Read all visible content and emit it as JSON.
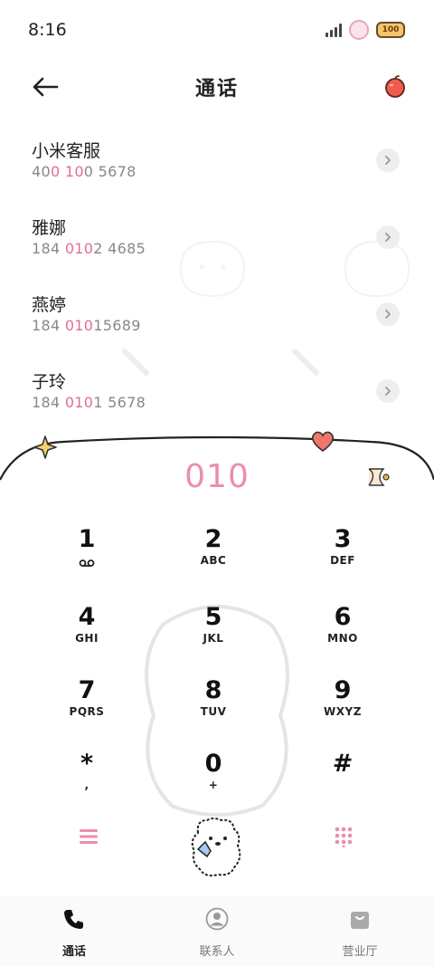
{
  "status_bar": {
    "time": "8:16",
    "battery": "100"
  },
  "header": {
    "title": "通话",
    "back_icon": "arrow-left-icon",
    "action_icon": "apple-icon"
  },
  "contacts": [
    {
      "name": "小米客服",
      "number_pre": "40",
      "number_hl1": "0 10",
      "number_post": "0 5678",
      "raw": "400 100 5678"
    },
    {
      "name": "雅娜",
      "number_pre": "184 ",
      "number_hl1": "010",
      "number_post": "2 4685",
      "raw": "184 0102 4685"
    },
    {
      "name": "燕婷",
      "number_pre": "184 ",
      "number_hl1": "010",
      "number_post": "15689",
      "raw": "184 01015689"
    },
    {
      "name": "子玲",
      "number_pre": "184 ",
      "number_hl1": "010",
      "number_post": "1 5678",
      "raw": "184 0101 5678"
    }
  ],
  "dialpad": {
    "entered": "010",
    "keys": [
      {
        "digit": "1",
        "letters": ""
      },
      {
        "digit": "2",
        "letters": "ABC"
      },
      {
        "digit": "3",
        "letters": "DEF"
      },
      {
        "digit": "4",
        "letters": "GHI"
      },
      {
        "digit": "5",
        "letters": "JKL"
      },
      {
        "digit": "6",
        "letters": "MNO"
      },
      {
        "digit": "7",
        "letters": "PQRS"
      },
      {
        "digit": "8",
        "letters": "TUV"
      },
      {
        "digit": "9",
        "letters": "WXYZ"
      },
      {
        "digit": "*",
        "letters": ","
      },
      {
        "digit": "0",
        "letters": "+"
      },
      {
        "digit": "#",
        "letters": ""
      }
    ]
  },
  "bottom_nav": [
    {
      "label": "通话",
      "icon": "phone-icon",
      "active": true
    },
    {
      "label": "联系人",
      "icon": "person-icon",
      "active": false
    },
    {
      "label": "营业厅",
      "icon": "shopping-bag-icon",
      "active": false
    }
  ],
  "colors": {
    "accent": "#ec8fa9",
    "highlight": "#e66c92",
    "text": "#222222",
    "muted": "#888888"
  }
}
